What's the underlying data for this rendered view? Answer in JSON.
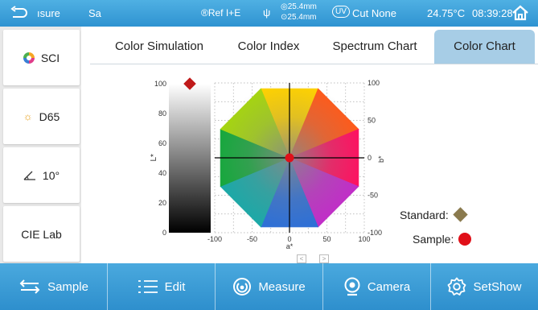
{
  "status_bar": {
    "mode_label": "ısure",
    "file_label": "Sa",
    "ref_label": "®Ref I+E",
    "aperture_top": "◎25.4mm",
    "aperture_bottom": "⊙25.4mm",
    "uv_label": "UV",
    "cut_label": "Cut None",
    "temperature": "24.75°C",
    "time": "08:39:28"
  },
  "left_panel": {
    "items": [
      {
        "label": "SCI",
        "icon": "color-ring-icon"
      },
      {
        "label": "D65",
        "icon": "sun-icon"
      },
      {
        "label": "10°",
        "icon": "angle-icon"
      },
      {
        "label": "CIE Lab",
        "icon": ""
      }
    ]
  },
  "tabs": [
    {
      "label": "Color Simulation",
      "active": false
    },
    {
      "label": "Color Index",
      "active": false
    },
    {
      "label": "Spectrum Chart",
      "active": false
    },
    {
      "label": "Color Chart",
      "active": true
    }
  ],
  "chart_data": {
    "type": "scatter",
    "lightness_bar": {
      "axis_label": "L*",
      "ticks": [
        "100",
        "80",
        "60",
        "40",
        "20",
        "0"
      ],
      "range": [
        0,
        100
      ],
      "standard_marker_value": 100
    },
    "ab_plane": {
      "xlabel": "a*",
      "ylabel": "b*",
      "x_ticks": [
        "-100",
        "-50",
        "0",
        "50",
        "100"
      ],
      "y_ticks": [
        "100",
        "50",
        "0",
        "-50",
        "-100"
      ],
      "xlim": [
        -100,
        100
      ],
      "ylim": [
        -100,
        100
      ],
      "grid": true,
      "points": [
        {
          "series": "Sample",
          "a": 0,
          "b": 0,
          "color": "#e01019"
        }
      ]
    },
    "legend": [
      {
        "label": "Standard:",
        "marker": "diamond",
        "color": "#8a7a4e"
      },
      {
        "label": "Sample:",
        "marker": "circle",
        "color": "#e01019"
      }
    ],
    "legend_placement": "bottom-right"
  },
  "bottom_bar": {
    "items": [
      {
        "label": "Sample",
        "icon": "swap-arrows-icon"
      },
      {
        "label": "Edit",
        "icon": "list-icon"
      },
      {
        "label": "Measure",
        "icon": "measure-icon"
      },
      {
        "label": "Camera",
        "icon": "camera-icon"
      },
      {
        "label": "SetShow",
        "icon": "settings-icon"
      }
    ]
  },
  "colors": {
    "header": "#3aa0da",
    "active_tab": "#a7cde6",
    "sample": "#e01019",
    "standard": "#8a7a4e"
  }
}
